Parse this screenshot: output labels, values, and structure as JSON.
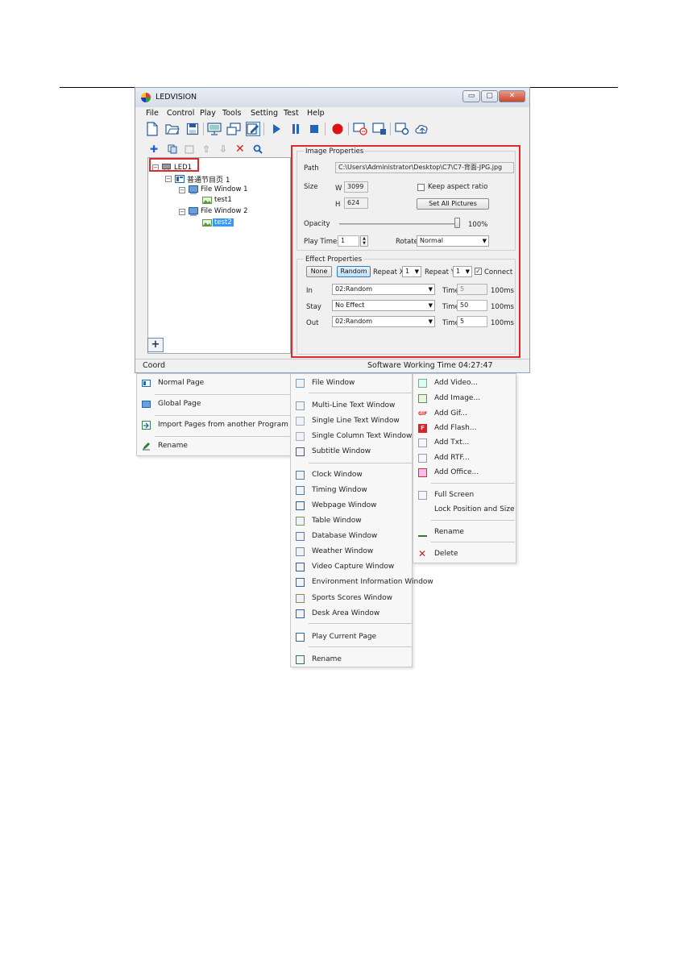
{
  "window": {
    "title": "LEDVISION",
    "controls": [
      "▭",
      "▢",
      "✕"
    ]
  },
  "menubar": [
    "File",
    "Control",
    "Play",
    "Tools",
    "Setting",
    "Test",
    "Help"
  ],
  "tree": {
    "root": "LED1",
    "page": "普通节目页 1",
    "windows": [
      {
        "label": "File Window 1",
        "item": "test1"
      },
      {
        "label": "File Window 2",
        "item": "test2"
      }
    ]
  },
  "image_properties": {
    "header": "Image Properties",
    "path_label": "Path",
    "path_value": "C:\\Users\\Administrator\\Desktop\\C7\\C7-背面-JPG.jpg",
    "size_label": "Size",
    "w_label": "W",
    "w_value": "3099",
    "h_label": "H",
    "h_value": "624",
    "keep_aspect_label": "Keep aspect ratio",
    "set_all_label": "Set All Pictures",
    "opacity_label": "Opacity",
    "opacity_value": "100%",
    "opacity_level": 1.0,
    "play_times_label": "Play Times",
    "play_times_value": "1",
    "rotate_label": "Rotate",
    "rotate_value": "Normal"
  },
  "effect_properties": {
    "header": "Effect Properties",
    "none_label": "None",
    "random_label": "Random",
    "repeat_x_label": "Repeat X",
    "repeat_x_value": "1",
    "repeat_y_label": "Repeat Y",
    "repeat_y_value": "1",
    "connect_label": "Connect",
    "connect_checked": "✓",
    "rows": [
      {
        "label": "In",
        "effect": "02:Random",
        "time_label": "Time",
        "time": "5",
        "unit": "100ms"
      },
      {
        "label": "Stay",
        "effect": "No Effect",
        "time_label": "Time",
        "time": "50",
        "unit": "100ms"
      },
      {
        "label": "Out",
        "effect": "02:Random",
        "time_label": "Time",
        "time": "5",
        "unit": "100ms"
      }
    ]
  },
  "statusbar": {
    "left": "Coord",
    "right": "Software Working Time 04:27:47"
  },
  "menu_page": [
    "Normal Page",
    "Global Page",
    "Import Pages from another Program",
    "Rename"
  ],
  "menu_window": [
    "File Window",
    "Multi-Line Text Window",
    "Single Line Text Window",
    "Single Column Text Window",
    "Subtitle Window",
    "Clock Window",
    "Timing Window",
    "Webpage Window",
    "Table Window",
    "Database Window",
    "Weather Window",
    "Video Capture Window",
    "Environment Information Window",
    "Sports Scores Window",
    "Desk Area Window",
    "Play Current Page",
    "Rename"
  ],
  "menu_file": [
    "Add Video...",
    "Add Image...",
    "Add Gif...",
    "Add Flash...",
    "Add Txt...",
    "Add RTF...",
    "Add Office...",
    "Full Screen",
    "Lock Position and Size",
    "Rename",
    "Delete"
  ],
  "icon_badges": {
    "gif": "GIF",
    "flash": "F"
  },
  "colors": {
    "highlight": "#e02a2a",
    "selection": "#3399ff",
    "accent_blue": "#2266bb"
  }
}
